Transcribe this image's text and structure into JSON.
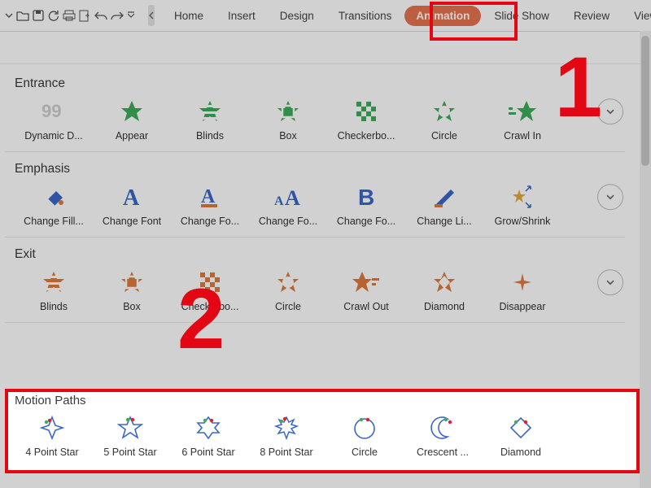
{
  "ribbon": {
    "home": "Home",
    "insert": "Insert",
    "design": "Design",
    "transitions": "Transitions",
    "animation": "Animation",
    "slideshow": "Slide Show",
    "review": "Review",
    "view": "View"
  },
  "annotations": {
    "one": "1",
    "two": "2"
  },
  "entrance": {
    "title": "Entrance",
    "items": [
      "Dynamic D...",
      "Appear",
      "Blinds",
      "Box",
      "Checkerbo...",
      "Circle",
      "Crawl In"
    ]
  },
  "emphasis": {
    "title": "Emphasis",
    "items": [
      "Change Fill...",
      "Change Font",
      "Change Fo...",
      "Change Fo...",
      "Change Fo...",
      "Change Li...",
      "Grow/Shrink"
    ]
  },
  "exit": {
    "title": "Exit",
    "items": [
      "Blinds",
      "Box",
      "Checkerbo...",
      "Circle",
      "Crawl Out",
      "Diamond",
      "Disappear"
    ]
  },
  "motion": {
    "title": "Motion Paths",
    "items": [
      "4 Point Star",
      "5 Point Star",
      "6 Point Star",
      "8 Point Star",
      "Circle",
      "Crescent ...",
      "Diamond"
    ]
  }
}
